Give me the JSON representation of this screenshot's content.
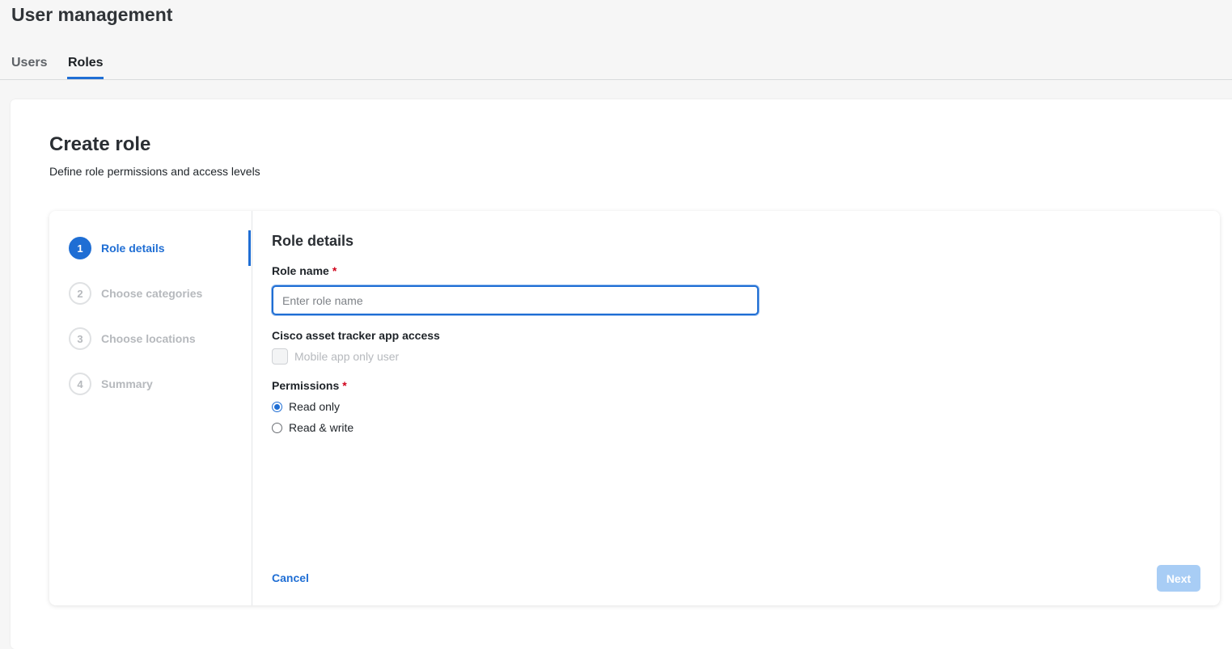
{
  "page": {
    "title": "User management"
  },
  "tabs": [
    {
      "label": "Users",
      "active": false
    },
    {
      "label": "Roles",
      "active": true
    }
  ],
  "card": {
    "title": "Create role",
    "subtitle": "Define role permissions and access levels"
  },
  "steps": [
    {
      "number": "1",
      "label": "Role details",
      "active": true
    },
    {
      "number": "2",
      "label": "Choose categories",
      "active": false
    },
    {
      "number": "3",
      "label": "Choose locations",
      "active": false
    },
    {
      "number": "4",
      "label": "Summary",
      "active": false
    }
  ],
  "form": {
    "section_title": "Role details",
    "role_name": {
      "label": "Role name",
      "required_mark": "*",
      "value": "",
      "placeholder": "Enter role name"
    },
    "app_access": {
      "label": "Cisco asset tracker app access",
      "checkbox_label": "Mobile app only user",
      "checked": false,
      "disabled": true
    },
    "permissions": {
      "label": "Permissions",
      "required_mark": "*",
      "options": [
        {
          "label": "Read only",
          "checked": true
        },
        {
          "label": "Read & write",
          "checked": false
        }
      ]
    }
  },
  "footer": {
    "cancel_label": "Cancel",
    "next_label": "Next",
    "next_disabled": true
  },
  "colors": {
    "accent": "#1f6ed4",
    "required": "#d0021b",
    "next_disabled_bg": "#a8cdf5"
  }
}
